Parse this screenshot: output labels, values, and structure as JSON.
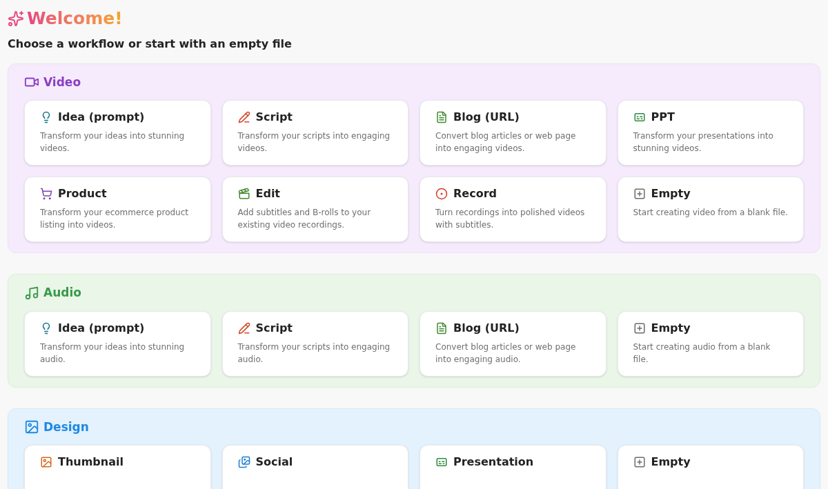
{
  "header": {
    "title": "Welcome!",
    "subtitle": "Choose a workflow or start with an empty file"
  },
  "sections": [
    {
      "kind": "video",
      "title": "Video",
      "cards": [
        {
          "kind": "idea",
          "title": "Idea (prompt)",
          "description": "Transform your ideas into stunning videos."
        },
        {
          "kind": "script",
          "title": "Script",
          "description": "Transform your scripts into engaging videos."
        },
        {
          "kind": "blog",
          "title": "Blog (URL)",
          "description": "Convert blog articles or web page into engaging videos."
        },
        {
          "kind": "ppt",
          "title": "PPT",
          "description": "Transform your presentations into stunning videos."
        },
        {
          "kind": "product",
          "title": "Product",
          "description": "Transform your ecommerce product listing into videos."
        },
        {
          "kind": "edit",
          "title": "Edit",
          "description": "Add subtitles and B-rolls to your existing video recordings."
        },
        {
          "kind": "record",
          "title": "Record",
          "description": "Turn recordings into polished videos with subtitles."
        },
        {
          "kind": "empty",
          "title": "Empty",
          "description": "Start creating video from a blank file."
        }
      ]
    },
    {
      "kind": "audio",
      "title": "Audio",
      "cards": [
        {
          "kind": "idea",
          "title": "Idea (prompt)",
          "description": "Transform your ideas into stunning audio."
        },
        {
          "kind": "script",
          "title": "Script",
          "description": "Transform your scripts into engaging audio."
        },
        {
          "kind": "blog",
          "title": "Blog (URL)",
          "description": "Convert blog articles or web page into engaging audio."
        },
        {
          "kind": "empty",
          "title": "Empty",
          "description": "Start creating audio from a blank file."
        }
      ]
    },
    {
      "kind": "design",
      "title": "Design",
      "cards": [
        {
          "kind": "thumbnail",
          "title": "Thumbnail"
        },
        {
          "kind": "social",
          "title": "Social"
        },
        {
          "kind": "ppt",
          "title": "Presentation"
        },
        {
          "kind": "empty",
          "title": "Empty"
        }
      ]
    }
  ]
}
